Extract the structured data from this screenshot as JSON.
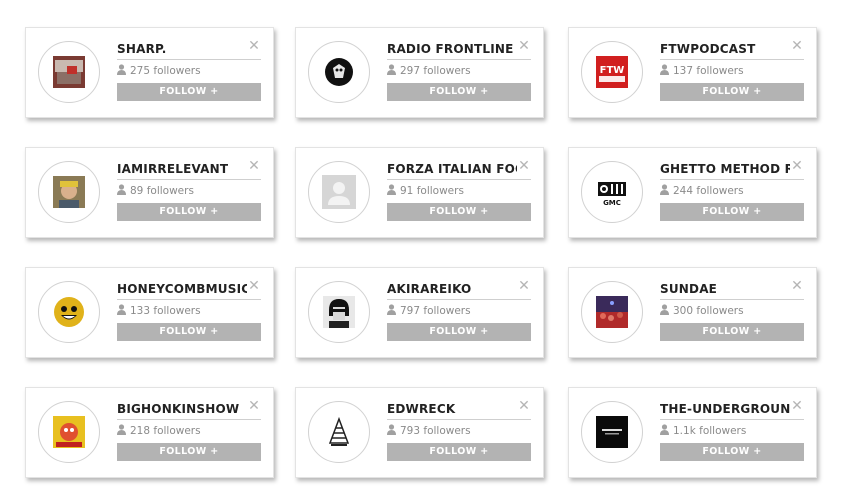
{
  "follow_label": "FOLLOW +",
  "close_symbol": "✕",
  "cards": [
    {
      "name": "SHARP.",
      "followers": "275 followers"
    },
    {
      "name": "RADIO FRONTLINE",
      "followers": "297 followers"
    },
    {
      "name": "FTWPODCAST",
      "followers": "137 followers",
      "thumb_text": "FTW"
    },
    {
      "name": "IAMIRRELEVANT",
      "followers": "89 followers"
    },
    {
      "name": "FORZA ITALIAN FOOTE",
      "followers": "91 followers"
    },
    {
      "name": "GHETTO METHOD RADI",
      "followers": "244 followers",
      "thumb_text": "GMC"
    },
    {
      "name": "HONEYCOMBMUSIC",
      "followers": "133 followers"
    },
    {
      "name": "AKIRAREIKO",
      "followers": "797 followers"
    },
    {
      "name": "SUNDAE",
      "followers": "300 followers"
    },
    {
      "name": "BIGHONKINSHOW",
      "followers": "218 followers"
    },
    {
      "name": "EDWRECK",
      "followers": "793 followers"
    },
    {
      "name": "THE-UNDERGROUND-S",
      "followers": "1.1k followers"
    }
  ],
  "colors": {
    "button": "#b3b3b3",
    "button_text": "#ffffff",
    "name_text": "#222222",
    "followers_text": "#8a8a8a",
    "close": "#b5b5b5"
  }
}
